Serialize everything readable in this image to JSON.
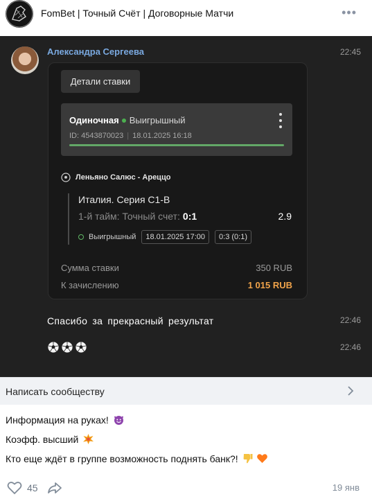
{
  "header": {
    "title": "FomBet | Точный Счёт | Договорные Матчи",
    "more": "•••"
  },
  "chat": {
    "author": "Александра Сергеева",
    "time_main": "22:45",
    "details_button": "Детали ставки",
    "bet": {
      "type": "Одиночная",
      "status": "Выигрышный",
      "id": "ID: 4543870023",
      "datetime": "18.01.2025 16:18",
      "progress": 1.0,
      "match": "Леньяно Салюс - Ареццо",
      "league": "Италия. Серия С1-В",
      "market": "1-й тайм: Точный счет:",
      "score": "0:1",
      "odds": "2.9",
      "event_status": "Выигрышный",
      "event_date": "18.01.2025 17:00",
      "final_score": "0:3 (0:1)",
      "stake_label": "Сумма ставки",
      "stake_value": "350 RUB",
      "payout_label": "К зачислению",
      "payout_value": "1 015 RUB"
    },
    "message1": "Спасибо за прекрасный результат",
    "time1": "22:46",
    "time2": "22:46"
  },
  "write": {
    "label": "Написать сообществу"
  },
  "post": {
    "line1": "Информация на руках!",
    "line2": "Коэфф. высший",
    "line3": "Кто еще ждёт в группе возможность поднять банк?!"
  },
  "footer": {
    "likes": "45",
    "date": "19 янв"
  },
  "colors": {
    "accent_name": "#7aa9e0",
    "payout": "#f0a34a",
    "win_green": "#4caf50"
  }
}
